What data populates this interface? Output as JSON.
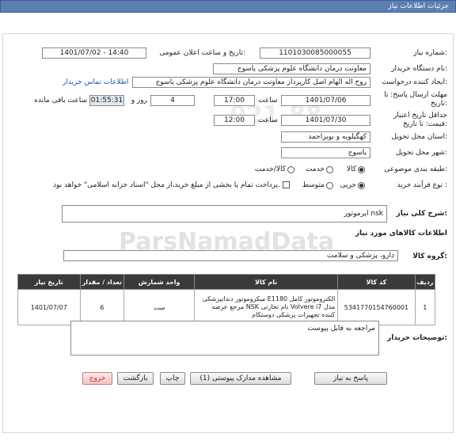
{
  "header": {
    "title": "جزئیات اطلاعات نیاز"
  },
  "form": {
    "need_number_label": "شماره نیاز:",
    "need_number": "1101030085000055",
    "announce_label": "تاریخ و ساعت اعلان عمومی:",
    "announce_value": "1401/07/02 - 14:40",
    "buyer_label": "نام دستگاه خریدار:",
    "buyer_value": "معاونت درمان دانشگاه علوم پزشکی یاسوج",
    "creator_label": "ایجاد کننده درخواست:",
    "creator_value": "روح اله الهام اصل کارپرداز معاونت درمان دانشگاه علوم پزشکی یاسوج",
    "contact_link": "اطلاعات تماس خریدار",
    "reply_deadline_label": "مهلت ارسال پاسخ: تا تاریخ:",
    "reply_date": "1401/07/06",
    "hour_label": "ساعت",
    "reply_hour": "17:00",
    "days_value": "4",
    "days_label": "روز و",
    "remaining_time": "01:55:31",
    "remaining_label": "ساعت باقی مانده",
    "validity_label": "حداقل تاریخ اعتبار قیمت: تا تاریخ:",
    "validity_date": "1401/07/30",
    "validity_hour_label": "ساعت",
    "validity_hour": "12:00",
    "province_label": "استان محل تحویل:",
    "province_value": "کهگیلویه و بویراحمد",
    "city_label": "شهر محل تحویل:",
    "city_value": "یاسوج",
    "category_label": "طبقه بندی موضوعی:",
    "category_options": [
      "کالا",
      "خدمت",
      "کالا/خدمت"
    ],
    "purchase_type_label": "نوع فرآیند خرید :",
    "purchase_options": [
      "جزیی",
      "متوسط"
    ],
    "payment_note": "پرداخت تمام یا بخشی از مبلغ خرید،از محل \"اسناد خزانه اسلامی\" خواهد بود."
  },
  "summary": {
    "label": "شرح کلی نیاز:",
    "value": "ایرموتور nsk"
  },
  "goods": {
    "section_title": "اطلاعات کالاهای مورد نیاز",
    "group_label": "گروه کالا:",
    "group_value": "دارو، پزشکی و سلامت",
    "columns": [
      "ردیف",
      "کد کالا",
      "نام کالا",
      "واحد شمارش",
      "تعداد / مقدار",
      "تاریخ نیاز"
    ],
    "rows": [
      {
        "row": "1",
        "code": "5341770154760001",
        "name": "الکتروموتور کامل E1180 میکروموتور دندانپزشکی مدل Volvere i7 نام تجارتی NSK مرجع عرضه کننده تجهیزات پزشکی دوستکام",
        "unit": "ست",
        "qty": "6",
        "date": "1401/07/07"
      }
    ]
  },
  "buyer_notes": {
    "label": "توضیحات خریدار:",
    "value": "مراجعه به فایل پیوست"
  },
  "buttons": {
    "reply": "پاسخ به نیاز",
    "docs": "مشاهده مدارک پیوستی (1)",
    "print": "چاپ",
    "back": "بازگشت",
    "exit": "خروج"
  },
  "watermark": {
    "brand": "ParsNamadData",
    "digits": "021-88"
  }
}
